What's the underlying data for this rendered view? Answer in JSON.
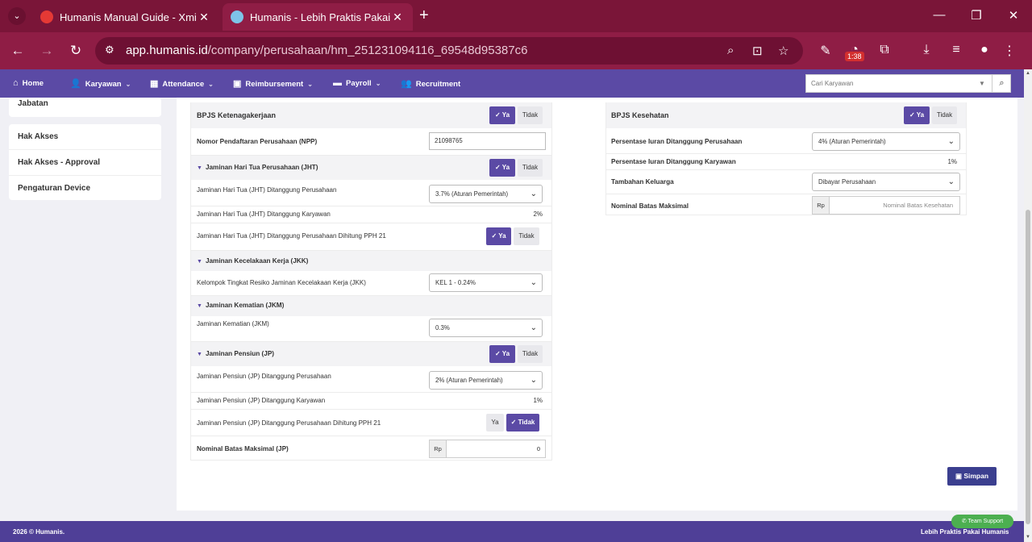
{
  "browser": {
    "tabs": [
      {
        "title": "Humanis Manual Guide - Xmind",
        "favicon_color": "#e53935"
      },
      {
        "title": "Humanis - Lebih Praktis Pakai Humanis",
        "favicon_color": "#7ec4e8"
      }
    ],
    "url_host": "app.humanis.id",
    "url_path": "/company/perusahaan/hm_251231094116_69548d95387c6",
    "badge_time": "1:38"
  },
  "nav": {
    "home": "Home",
    "karyawan": "Karyawan",
    "attendance": "Attendance",
    "reimbursement": "Reimbursement",
    "payroll": "Payroll",
    "recruitment": "Recruitment",
    "search_placeholder": "Cari Karyawan"
  },
  "sidebar": {
    "items": [
      "Jabatan",
      "Hak Akses",
      "Hak Akses - Approval",
      "Pengaturan Device"
    ]
  },
  "common": {
    "ya": "Ya",
    "tidak": "Tidak",
    "rp": "Rp"
  },
  "ketenagakerjaan": {
    "title": "BPJS Ketenagakerjaan",
    "npp_label": "Nomor Pendaftaran Perusahaan (NPP)",
    "npp_value": "21098765",
    "jht_title": "Jaminan Hari Tua Perusahaan (JHT)",
    "jht_perusahaan_label": "Jaminan Hari Tua (JHT) Ditanggung Perusahaan",
    "jht_perusahaan_value": "3.7% (Aturan Pemerintah)",
    "jht_karyawan_label": "Jaminan Hari Tua (JHT) Ditanggung Karyawan",
    "jht_karyawan_value": "2%",
    "jht_pph_label": "Jaminan Hari Tua (JHT) Ditanggung Perusahaan Dihitung PPH 21",
    "jkk_title": "Jaminan Kecelakaan Kerja (JKK)",
    "jkk_label": "Kelompok Tingkat Resiko Jaminan Kecelakaan Kerja (JKK)",
    "jkk_value": "KEL 1 - 0.24%",
    "jkm_title": "Jaminan Kematian (JKM)",
    "jkm_label": "Jaminan Kematian (JKM)",
    "jkm_value": "0.3%",
    "jp_title": "Jaminan Pensiun (JP)",
    "jp_perusahaan_label": "Jaminan Pensiun (JP) Ditanggung Perusahaan",
    "jp_perusahaan_value": "2% (Aturan Pemerintah)",
    "jp_karyawan_label": "Jaminan Pensiun (JP) Ditanggung Karyawan",
    "jp_karyawan_value": "1%",
    "jp_pph_label": "Jaminan Pensiun (JP) Ditanggung Perusahaan Dihitung PPH 21",
    "nominal_jp_label": "Nominal Batas Maksimal (JP)",
    "nominal_jp_value": "0"
  },
  "kesehatan": {
    "title": "BPJS Kesehatan",
    "iuran_perusahaan_label": "Persentase Iuran Ditanggung Perusahaan",
    "iuran_perusahaan_value": "4% (Aturan Pemerintah)",
    "iuran_karyawan_label": "Persentase Iuran Ditanggung Karyawan",
    "iuran_karyawan_value": "1%",
    "keluarga_label": "Tambahan Keluarga",
    "keluarga_value": "Dibayar Perusahaan",
    "nominal_label": "Nominal Batas Maksimal",
    "nominal_placeholder": "Nominal Batas Kesehatan"
  },
  "save_label": "Simpan",
  "footer": {
    "left": "2026 © Humanis.",
    "right": "Lebih Praktis Pakai Humanis",
    "support": "Team Support"
  },
  "colors": {
    "primary": "#5b4aa5",
    "chrome": "#8f1d45",
    "save": "#3b3f8f"
  }
}
